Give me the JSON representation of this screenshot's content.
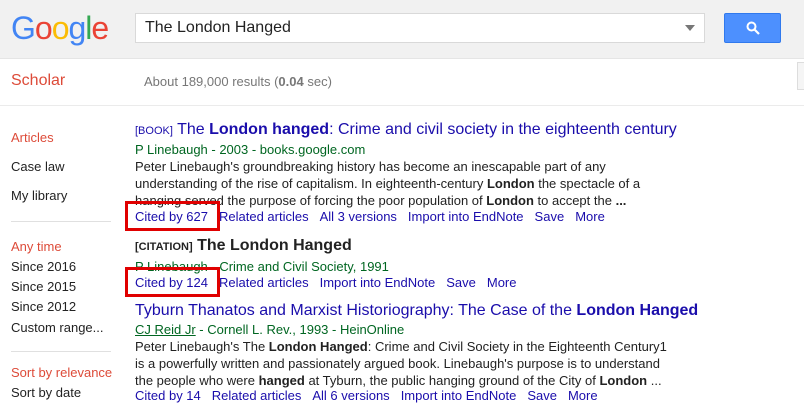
{
  "logo": {
    "letters": [
      "G",
      "o",
      "o",
      "g",
      "l",
      "e"
    ]
  },
  "search": {
    "value": "The London Hanged"
  },
  "nav": {
    "scholar_label": "Scholar",
    "results_prefix": "About 189,000 results (",
    "results_time": "0.04",
    "results_suffix": " sec)"
  },
  "sidebar": {
    "articles": "Articles",
    "case_law": "Case law",
    "my_library": "My library",
    "any_time": "Any time",
    "since_2016": "Since 2016",
    "since_2015": "Since 2015",
    "since_2012": "Since 2012",
    "custom_range": "Custom range...",
    "sort_relevance": "Sort by relevance",
    "sort_date": "Sort by date"
  },
  "results": [
    {
      "tag": "[BOOK]",
      "title_pre": "The ",
      "title_bold": "London hanged",
      "title_post": ": Crime and civil society in the eighteenth century",
      "meta": "P Linebaugh - 2003 - books.google.com",
      "snippet_1a": "Peter Linebaugh's groundbreaking history has become an inescapable part of any",
      "snippet_2a": "understanding of the rise of capitalism. In eighteenth-century ",
      "snippet_2b": "London",
      "snippet_2c": " the spectacle of a",
      "snippet_3a": "hanging served the purpose of forcing the poor population of ",
      "snippet_3b": "London",
      "snippet_3c": " to accept the ",
      "snippet_3d": "...",
      "cited": "Cited by 627",
      "related": "Related articles",
      "versions": "All 3 versions",
      "import": "Import into EndNote",
      "save": "Save",
      "more": "More"
    },
    {
      "tag": "[CITATION]",
      "title": "The London Hanged",
      "meta": "P Linebaugh - Crime and Civil Society, 1991",
      "cited": "Cited by 124",
      "related": "Related articles",
      "import": "Import into EndNote",
      "save": "Save",
      "more": "More"
    },
    {
      "title_pre": "Tyburn Thanatos and Marxist Historiography: The Case of the ",
      "title_bold": "London Hanged",
      "author": "CJ Reid Jr",
      "meta_rest": " - Cornell L. Rev., 1993 - HeinOnline",
      "snippet_1a": "Peter Linebaugh's The ",
      "snippet_1b": "London Hanged",
      "snippet_1c": ": Crime and Civil Society in the Eighteenth Century1",
      "snippet_2": "is a powerfully written and passionately argued book. Linebaugh's purpose is to understand",
      "snippet_3a": "the people who were ",
      "snippet_3b": "hanged",
      "snippet_3c": " at Tyburn, the public hanging ground of the City of ",
      "snippet_3d": "London",
      "snippet_3e": " ...",
      "cited": "Cited by 14",
      "related": "Related articles",
      "versions": "All 6 versions",
      "import": "Import into EndNote",
      "save": "Save",
      "more": "More"
    }
  ],
  "colors": {
    "link": "#1a0dab",
    "meta_green": "#006621",
    "accent_red": "#dd4b39",
    "highlight_red": "#e00000",
    "search_blue": "#4d90fe"
  }
}
